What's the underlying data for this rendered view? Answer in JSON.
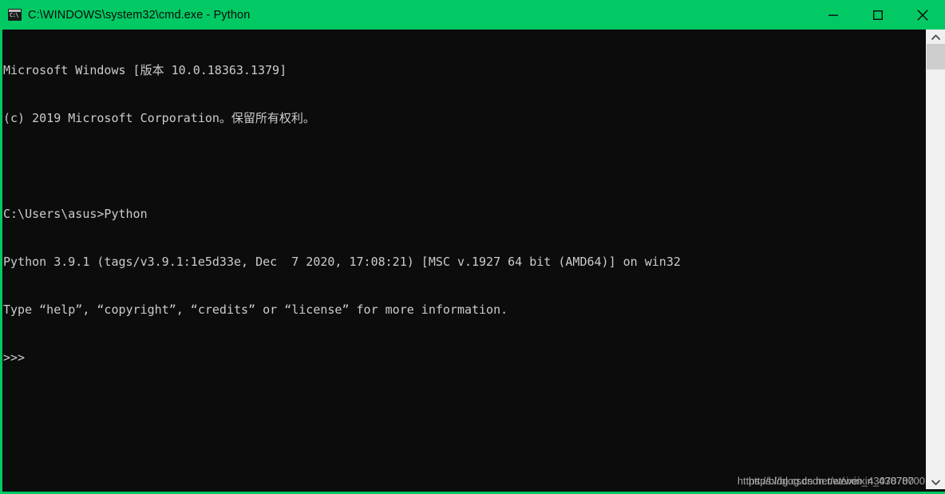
{
  "window": {
    "title": "C:\\WINDOWS\\system32\\cmd.exe - Python",
    "icon": "cmd-icon",
    "icon_label": "C:\\",
    "titlebar_color": "#02c964",
    "console_bg": "#0c0c0c",
    "console_fg": "#cccccc",
    "controls": {
      "minimize": "minimize-icon",
      "maximize": "maximize-icon",
      "close": "close-icon"
    }
  },
  "console": {
    "lines": [
      "Microsoft Windows [版本 10.0.18363.1379]",
      "(c) 2019 Microsoft Corporation。保留所有权利。",
      "",
      "C:\\Users\\asus>Python",
      "Python 3.9.1 (tags/v3.9.1:1e5d33e, Dec  7 2020, 17:08:21) [MSC v.1927 64 bit (AMD64)] on win32",
      "Type “help”, “copyright”, “credits” or “license” for more information.",
      ">>>"
    ]
  },
  "scrollbar": {
    "up_arrow": "chevron-up-icon",
    "down_arrow": "chevron-down-icon"
  },
  "watermark": {
    "line_a": "https://blog.csdn.net/weixin_43078700",
    "line_b": "https://blog.csdn.net/weixin_43078700"
  }
}
